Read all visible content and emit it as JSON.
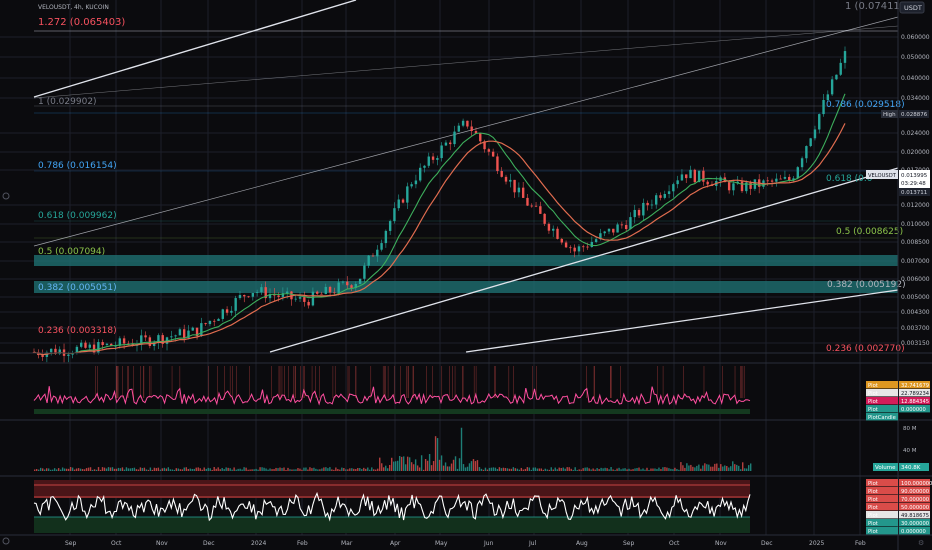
{
  "symbol": {
    "label": "VELOUSDT, 4h, KUCOIN"
  },
  "currency": {
    "label": "USDT"
  },
  "price_axis": {
    "ticks": [
      "0.060000",
      "0.050000",
      "0.040000",
      "0.034000",
      "0.024000",
      "0.020000",
      "0.017000",
      "0.012000",
      "0.010000",
      "0.008500",
      "0.007000",
      "0.006000",
      "0.005000",
      "0.004300",
      "0.003700",
      "0.003150"
    ],
    "high_label": "High",
    "high_value": "0.028876",
    "last_symbol": "VELOUSDT",
    "last_price": "0.013995",
    "countdown": "03:29:48",
    "other_price": "0.013711"
  },
  "fib_levels": [
    {
      "label": "1 (0.074110)",
      "color": "#787b86"
    },
    {
      "label": "1.272 (0.065403)",
      "color": "#f7525f"
    },
    {
      "label": "1 (0.029902)",
      "color": "#787b86"
    },
    {
      "label": "0.786 (0.029518)",
      "color": "#2196f3"
    },
    {
      "label": "0.786 (0.016154)",
      "color": "#2196f3"
    },
    {
      "label": "0.618 (0.009962)",
      "color": "#26a69a"
    },
    {
      "label": "0.618 (0.0",
      "color": "#26a69a"
    },
    {
      "label": "0.5 (0.007094)",
      "color": "#8bc34a"
    },
    {
      "label": "0.5 (0.008625)",
      "color": "#8bc34a"
    },
    {
      "label": "0.382 (0.005051)",
      "color": "#42a5f5"
    },
    {
      "label": "0.382 (0.005192)",
      "color": "#787b86"
    },
    {
      "label": "0.236 (0.003318)",
      "color": "#f7525f"
    },
    {
      "label": "0.236 (0.002770)",
      "color": "#f7525f"
    }
  ],
  "pane1_legend": [
    {
      "name": "Plot",
      "value": "32.741679",
      "color": "#f5a623"
    },
    {
      "name": "Plot",
      "value": "22.789234",
      "color": "#ffffff"
    },
    {
      "name": "Plot",
      "value": "12.884345",
      "color": "#e91e63"
    },
    {
      "name": "Plot",
      "value": "0.000000",
      "color": "#26a69a"
    },
    {
      "name": "PlotCandle",
      "value": "",
      "color": "#26a69a"
    }
  ],
  "pane2": {
    "ticks": [
      "80 M",
      "40 M"
    ],
    "volume_label": "Volume",
    "volume_value": "340.8K"
  },
  "pane3_legend": [
    {
      "name": "Plot",
      "value": "100.000000",
      "color": "#ef5350"
    },
    {
      "name": "Plot",
      "value": "90.000000",
      "color": "#ef5350"
    },
    {
      "name": "Plot",
      "value": "70.000000",
      "color": "#ef5350"
    },
    {
      "name": "Plot",
      "value": "50.000000",
      "color": "#ef5350"
    },
    {
      "name": "Plot",
      "value": "49.818675",
      "color": "#ffffff"
    },
    {
      "name": "Plot",
      "value": "30.000000",
      "color": "#26a69a"
    },
    {
      "name": "Plot",
      "value": "0.000000",
      "color": "#26a69a"
    }
  ],
  "time_axis": [
    "Sep",
    "Oct",
    "Nov",
    "Dec",
    "2024",
    "Feb",
    "Mar",
    "Apr",
    "May",
    "Jun",
    "Jul",
    "Aug",
    "Sep",
    "Oct",
    "Nov",
    "Dec",
    "2025",
    "Feb"
  ],
  "chart_data": {
    "type": "candlestick",
    "title": "VELOUSDT, 4h, KUCOIN",
    "x": [
      "Sep",
      "Oct",
      "Nov",
      "Dec",
      "2024",
      "Feb",
      "Mar",
      "Apr",
      "May",
      "Jun",
      "Jul",
      "Aug",
      "Sep",
      "Oct",
      "Nov",
      "Dec (early)"
    ],
    "series": [
      {
        "name": "",
        "values": [
          0.0028,
          0.0029,
          0.0031,
          0.0034,
          0.005,
          0.0045,
          0.0055,
          0.014,
          0.024,
          0.012,
          0.0072,
          0.0095,
          0.015,
          0.013,
          0.014,
          0.045
        ]
      }
    ],
    "y_scale": "log",
    "ylim": [
      0.0028,
      0.075
    ]
  }
}
